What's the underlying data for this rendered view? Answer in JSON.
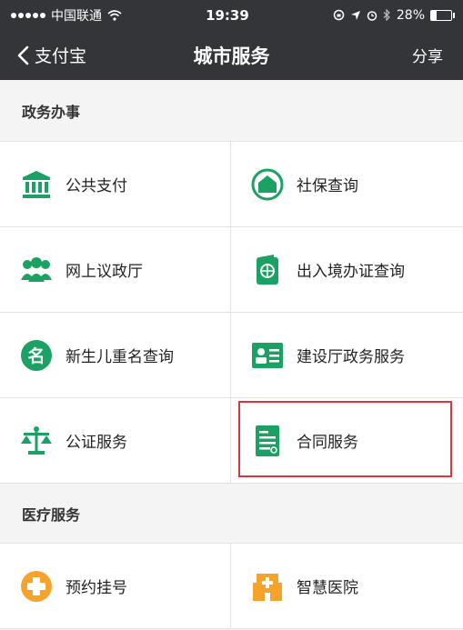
{
  "status": {
    "carrier": "中国联通",
    "time": "19:39",
    "battery": "28%"
  },
  "nav": {
    "back_label": "支付宝",
    "title": "城市服务",
    "share_label": "分享"
  },
  "sections": [
    {
      "title": "政务办事"
    },
    {
      "title": "医疗服务"
    }
  ],
  "gov_items": [
    {
      "label": "公共支付",
      "icon": "bank-icon"
    },
    {
      "label": "社保查询",
      "icon": "home-shield-icon"
    },
    {
      "label": "网上议政厅",
      "icon": "people-icon"
    },
    {
      "label": "出入境办证查询",
      "icon": "passport-icon"
    },
    {
      "label": "新生儿重名查询",
      "icon": "name-badge-icon"
    },
    {
      "label": "建设厅政务服务",
      "icon": "id-card-icon"
    },
    {
      "label": "公证服务",
      "icon": "scale-icon"
    },
    {
      "label": "合同服务",
      "icon": "contract-icon"
    }
  ],
  "med_items": [
    {
      "label": "预约挂号",
      "icon": "medical-cross-icon"
    },
    {
      "label": "智慧医院",
      "icon": "hospital-icon"
    }
  ],
  "colors": {
    "green": "#1aa163",
    "orange": "#f5a32a",
    "highlight": "#d9363e",
    "bar": "#333538"
  }
}
